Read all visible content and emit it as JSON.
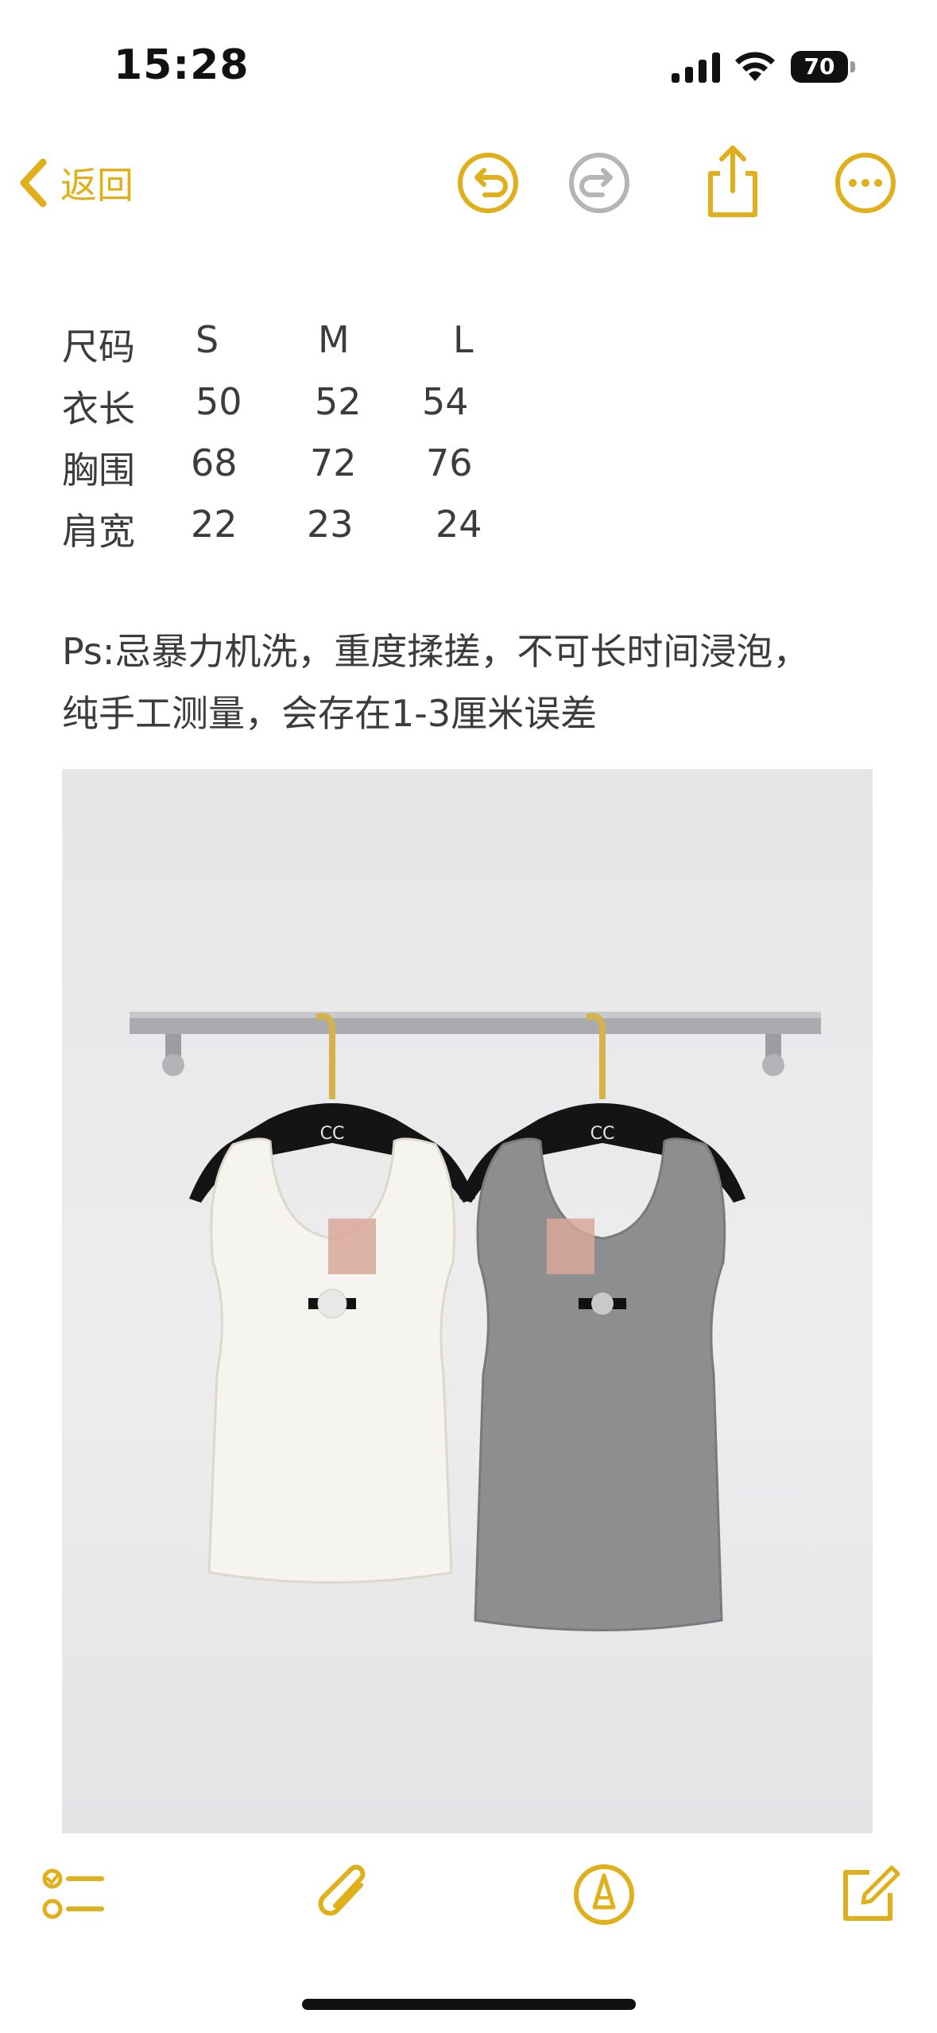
{
  "status_bar": {
    "time": "15:28",
    "battery_level": "70",
    "icons": [
      "cellular-signal-icon",
      "wifi-icon",
      "battery-icon"
    ]
  },
  "nav_bar": {
    "back_label": "返回",
    "icons": [
      "chevron-left-icon",
      "undo-icon",
      "redo-icon",
      "share-icon",
      "more-icon"
    ],
    "redo_enabled": false
  },
  "size_chart": {
    "rows": [
      {
        "label": "尺码",
        "values": [
          "S",
          "M",
          "L"
        ]
      },
      {
        "label": "衣长",
        "values": [
          "50",
          "52",
          "54"
        ]
      },
      {
        "label": "胸围",
        "values": [
          "68",
          "72",
          "76"
        ]
      },
      {
        "label": "肩宽",
        "values": [
          "22",
          "23",
          "24"
        ]
      }
    ]
  },
  "note": {
    "line1": "Ps:忌暴力机洗，重度揉搓，不可长时间浸泡，",
    "line2": "纯手工测量，会存在1-3厘米误差"
  },
  "toolbar": {
    "icons": [
      "checklist-icon",
      "paperclip-icon",
      "markup-pen-icon",
      "compose-icon"
    ]
  },
  "colors": {
    "accent": "#e0b01c",
    "disabled": "#b5b5b5",
    "text": "#3c3c3c"
  }
}
